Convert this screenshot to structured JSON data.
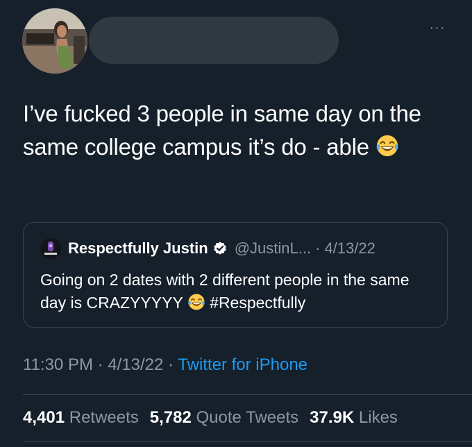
{
  "tweet": {
    "text": "I’ve fucked 3 people in same day on the same college campus it’s do - able",
    "emoji": "face-with-tears-of-joy",
    "more_label": "···",
    "time": "11:30 PM",
    "date": "4/13/22",
    "separator": "·",
    "source": "Twitter for iPhone"
  },
  "quote": {
    "name": "Respectfully Justin",
    "handle": "@JustinL...",
    "separator": "·",
    "date": "4/13/22",
    "text_before_emoji": "Going on 2 dates with 2 different people in the same day is CRAZYYYYY",
    "hashtag": "#Respectfully"
  },
  "stats": {
    "retweets_count": "4,401",
    "retweets_label": "Retweets",
    "quotes_count": "5,782",
    "quotes_label": "Quote Tweets",
    "likes_count": "37.9K",
    "likes_label": "Likes"
  },
  "colors": {
    "background": "#15202b",
    "muted": "#8b98a5",
    "link": "#1d9bf0",
    "border": "#38444d"
  }
}
